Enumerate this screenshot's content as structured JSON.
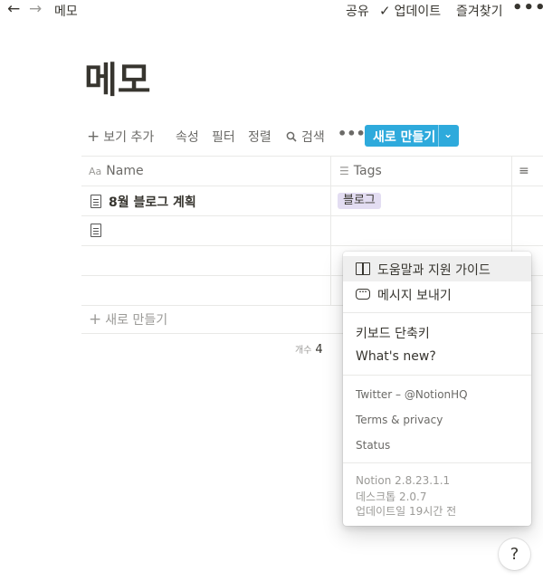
{
  "topbar": {
    "breadcrumb": "메모",
    "share": "공유",
    "updates": "업데이트",
    "favorite": "즐겨찾기",
    "more": "•••"
  },
  "page": {
    "title": "메모"
  },
  "toolbar": {
    "add_view": "보기 추가",
    "properties": "속성",
    "filter": "필터",
    "sort": "정렬",
    "search": "검색",
    "more": "•••",
    "new_button": "새로 만들기"
  },
  "table": {
    "columns": [
      {
        "label": "Name",
        "icon": "text-aa-icon"
      },
      {
        "label": "Tags",
        "icon": "list-icon"
      },
      {
        "label": "",
        "icon": "lines-icon"
      }
    ],
    "rows": [
      {
        "name": "8월 블로그 계획",
        "tag": "블로그"
      },
      {
        "name": "",
        "tag": ""
      }
    ],
    "new_row": "새로 만들기",
    "count_label": "개수",
    "count_value": "4"
  },
  "help_menu": {
    "guide": "도움말과 지원 가이드",
    "message": "메시지 보내기",
    "shortcuts": "키보드 단축키",
    "whats_new": "What's new?",
    "twitter": "Twitter – @NotionHQ",
    "terms": "Terms & privacy",
    "status": "Status",
    "version": "Notion 2.8.23.1.1",
    "desktop": "데스크톱 2.0.7",
    "updated": "업데이트일 19시간 전"
  },
  "help_button": "?",
  "colors": {
    "accent": "#2eaadc",
    "tag_bg": "#e3ddf2",
    "text": "#37352f"
  }
}
